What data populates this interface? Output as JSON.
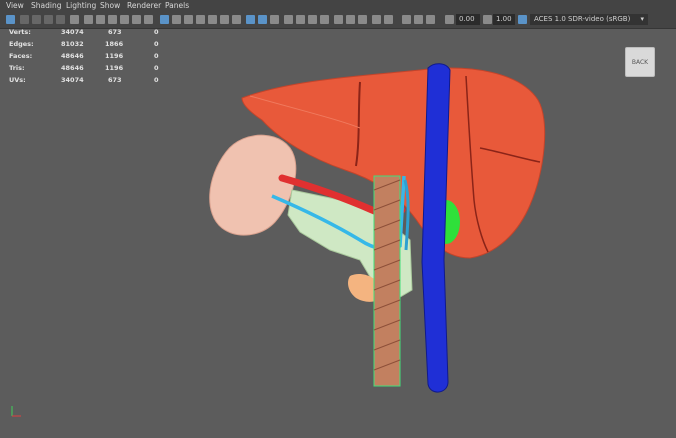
{
  "menu": [
    "View",
    "Shading",
    "Lighting",
    "Show",
    "Renderer",
    "Panels"
  ],
  "toolbar": {
    "exposure_value": "0.00",
    "gamma_value": "1.00",
    "color_space": "ACES 1.0 SDR-video (sRGB)"
  },
  "hud": {
    "rows": [
      {
        "label": "Verts:",
        "total": "34074",
        "selected": "673",
        "extra": "0"
      },
      {
        "label": "Edges:",
        "total": "81032",
        "selected": "1866",
        "extra": "0"
      },
      {
        "label": "Faces:",
        "total": "48646",
        "selected": "1196",
        "extra": "0"
      },
      {
        "label": "Tris:",
        "total": "48646",
        "selected": "1196",
        "extra": "0"
      },
      {
        "label": "UVs:",
        "total": "34074",
        "selected": "673",
        "extra": "0"
      }
    ]
  },
  "viewcube": {
    "label": "BACK"
  },
  "colors": {
    "viewport_bg": "#5c5c5c",
    "liver": "#e8593a",
    "vena_cava": "#1f2fd6",
    "gallbladder": "#2fe03a",
    "stomach": "#f0c2b0",
    "artery": "#e03030",
    "duct": "#36b8e8"
  }
}
